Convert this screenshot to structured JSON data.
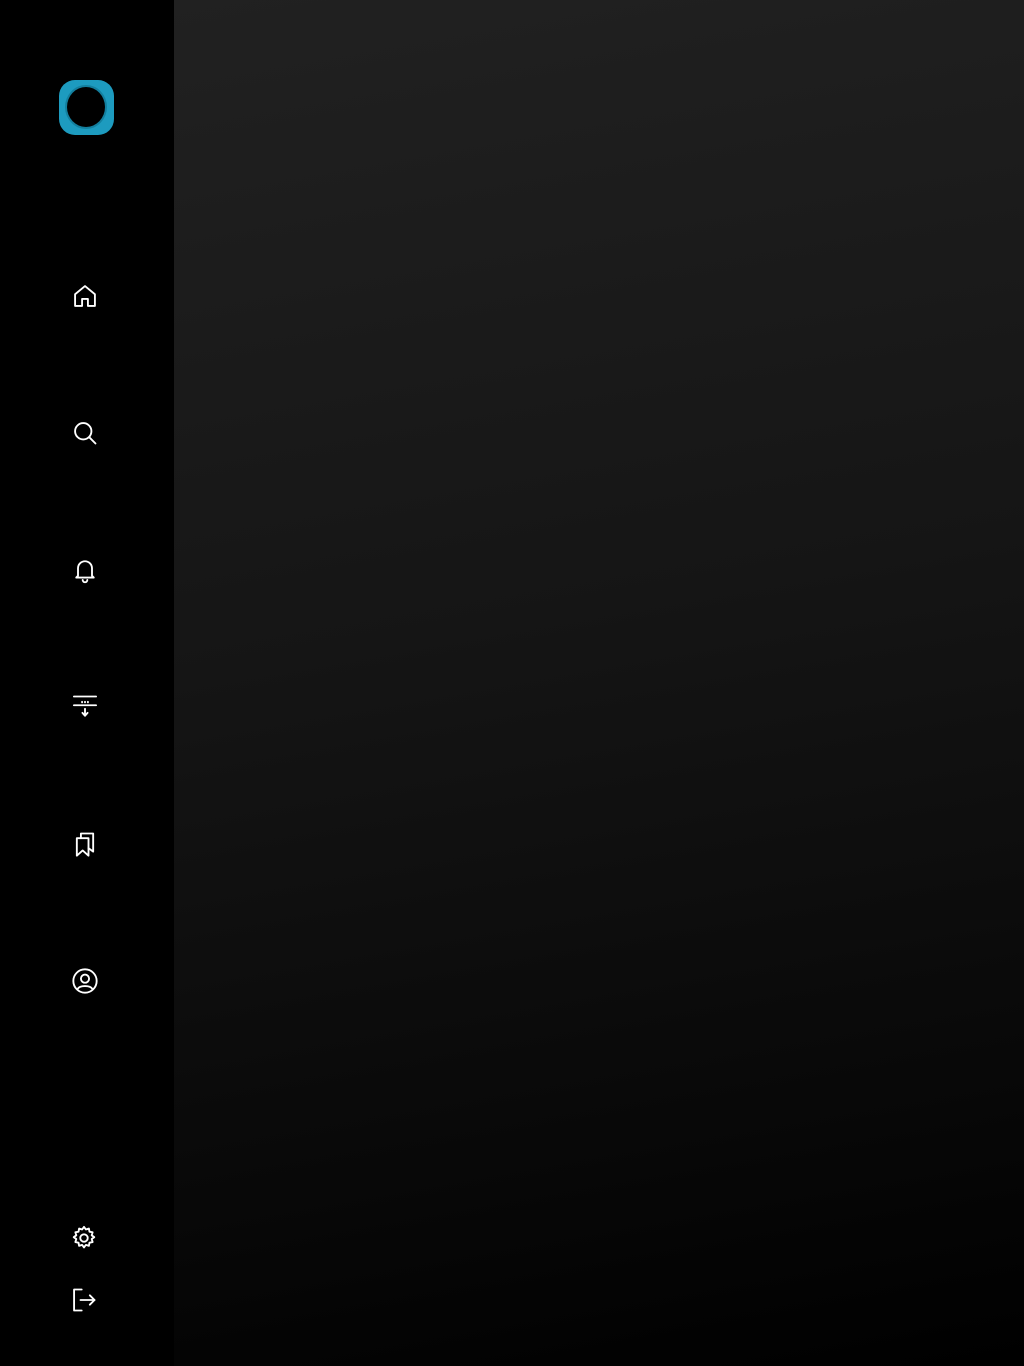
{
  "app": {
    "logo_icon": "app-logo-ring-icon",
    "brand_color": "#1d9bbf"
  },
  "sidebar": {
    "items": [
      {
        "icon": "home-icon"
      },
      {
        "icon": "search-icon"
      },
      {
        "icon": "bell-icon"
      },
      {
        "icon": "download-list-icon"
      },
      {
        "icon": "bookmarks-icon"
      },
      {
        "icon": "user-circle-icon"
      }
    ],
    "bottom_items": [
      {
        "icon": "gear-icon"
      },
      {
        "icon": "sign-out-icon"
      }
    ]
  },
  "main": {
    "background_top": "#212121",
    "background_bottom": "#000000"
  }
}
